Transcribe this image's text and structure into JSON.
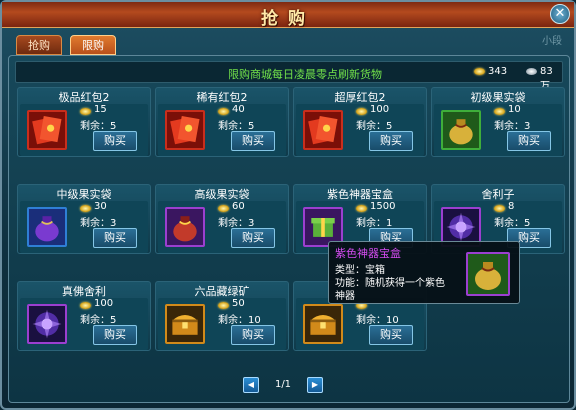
{
  "window": {
    "title": "抢购",
    "close_label": "✕"
  },
  "background_note": "小段",
  "tabs": [
    {
      "label": "抢购",
      "active": false
    },
    {
      "label": "限购",
      "active": true
    }
  ],
  "notice": "限购商城每日凌晨零点刷新货物",
  "currency": {
    "gold": "343",
    "silver": "83万"
  },
  "buy_label": "购买",
  "remain_prefix": "剩余：",
  "items": [
    {
      "name": "极品红包2",
      "price": "15",
      "remain": "5",
      "icon": "red-envelope-icon",
      "border": "#c92e1c"
    },
    {
      "name": "稀有红包2",
      "price": "40",
      "remain": "5",
      "icon": "red-envelope-icon",
      "border": "#c92e1c"
    },
    {
      "name": "超厚红包2",
      "price": "100",
      "remain": "5",
      "icon": "red-envelope-icon",
      "border": "#c92e1c"
    },
    {
      "name": "初级果实袋",
      "price": "10",
      "remain": "3",
      "icon": "gold-pouch-icon",
      "border": "#3fae3a"
    },
    {
      "name": "中级果实袋",
      "price": "30",
      "remain": "3",
      "icon": "purple-pouch-icon",
      "border": "#2f7fd6"
    },
    {
      "name": "高级果实袋",
      "price": "60",
      "remain": "3",
      "icon": "red-pouch-icon",
      "border": "#9b3fd0"
    },
    {
      "name": "紫色神器宝盒",
      "price": "1500",
      "remain": "1",
      "icon": "purple-box-icon",
      "border": "#9b3fd0"
    },
    {
      "name": "舍利子",
      "price": "8",
      "remain": "5",
      "icon": "relic-icon",
      "border": "#9b3fd0"
    },
    {
      "name": "真佛舍利",
      "price": "100",
      "remain": "5",
      "icon": "relic-icon",
      "border": "#9b3fd0"
    },
    {
      "name": "六品藏绿矿",
      "price": "50",
      "remain": "10",
      "icon": "treasure-chest-icon",
      "border": "#d28a1a"
    },
    {
      "name": "",
      "price": "",
      "remain": "10",
      "icon": "treasure-chest-icon",
      "border": "#d28a1a"
    }
  ],
  "pager": {
    "prev": "◀",
    "next": "▶",
    "label": "1/1"
  },
  "tooltip": {
    "title": "紫色神器宝盒",
    "type_line": "类型：宝箱",
    "func_line1": "功能：随机获得一个紫色",
    "func_line2": "神器",
    "icon": "gold-pouch-icon"
  }
}
